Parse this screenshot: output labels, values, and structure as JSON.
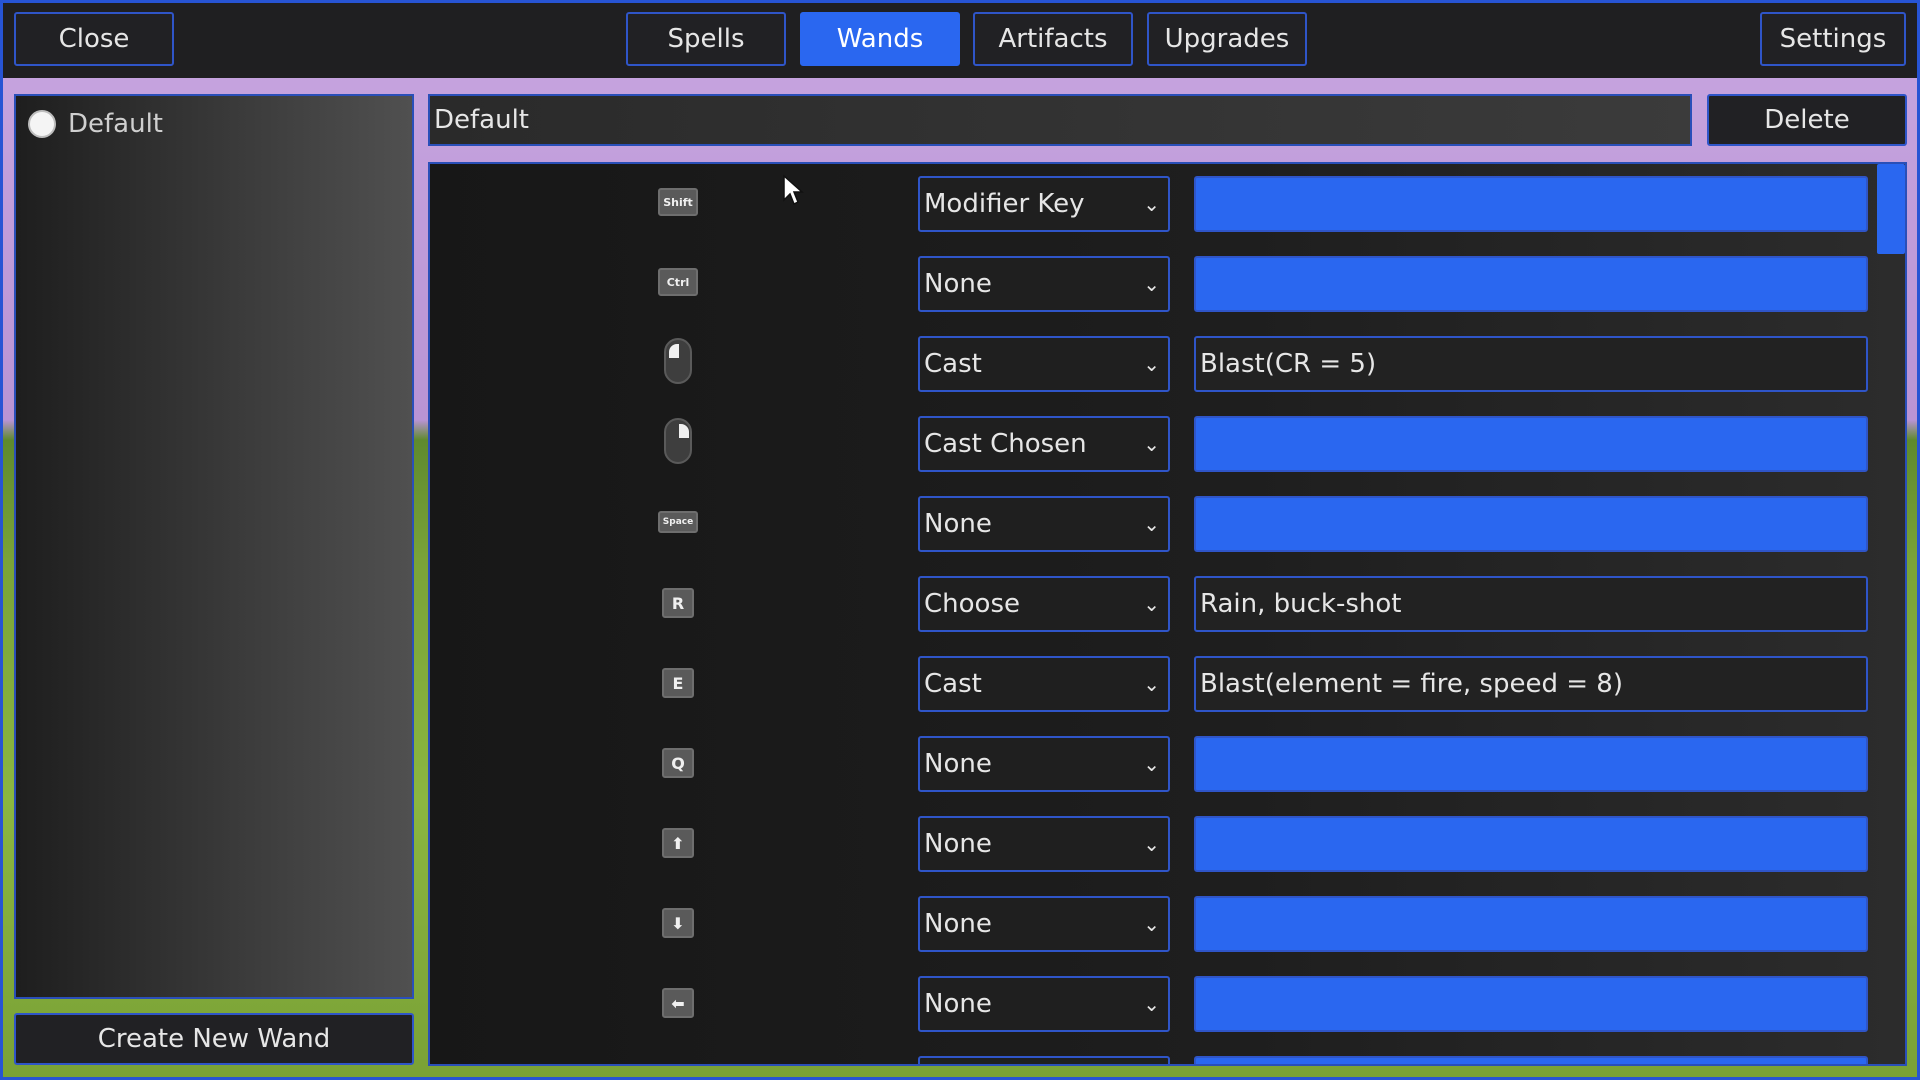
{
  "topbar": {
    "close_label": "Close",
    "tabs": [
      {
        "label": "Spells",
        "active": false
      },
      {
        "label": "Wands",
        "active": true
      },
      {
        "label": "Artifacts",
        "active": false
      },
      {
        "label": "Upgrades",
        "active": false
      }
    ],
    "settings_label": "Settings"
  },
  "sidebar": {
    "wands": [
      {
        "label": "Default",
        "selected": true
      }
    ],
    "create_label": "Create New Wand"
  },
  "editor": {
    "wand_name": "Default",
    "delete_label": "Delete",
    "bindings": [
      {
        "key": "Shift",
        "icon": "shift-key-icon",
        "action": "Modifier Key",
        "value": ""
      },
      {
        "key": "Ctrl",
        "icon": "ctrl-key-icon",
        "action": "None",
        "value": ""
      },
      {
        "key": "",
        "icon": "left-mouse-icon",
        "action": "Cast",
        "value": "Blast(CR = 5)"
      },
      {
        "key": "",
        "icon": "right-mouse-icon",
        "action": "Cast Chosen",
        "value": ""
      },
      {
        "key": "Space",
        "icon": "space-key-icon",
        "action": "None",
        "value": ""
      },
      {
        "key": "R",
        "icon": "r-key-icon",
        "action": "Choose",
        "value": "Rain, buck-shot"
      },
      {
        "key": "E",
        "icon": "e-key-icon",
        "action": "Cast",
        "value": "Blast(element = fire, speed = 8)"
      },
      {
        "key": "Q",
        "icon": "q-key-icon",
        "action": "None",
        "value": ""
      },
      {
        "key": "⬆",
        "icon": "up-arrow-key-icon",
        "action": "None",
        "value": ""
      },
      {
        "key": "⬇",
        "icon": "down-arrow-key-icon",
        "action": "None",
        "value": ""
      },
      {
        "key": "⬅",
        "icon": "left-arrow-key-icon",
        "action": "None",
        "value": ""
      }
    ]
  },
  "colors": {
    "accent": "#2a67f0",
    "border": "#2f55c8",
    "panel": "#1f1f21"
  }
}
